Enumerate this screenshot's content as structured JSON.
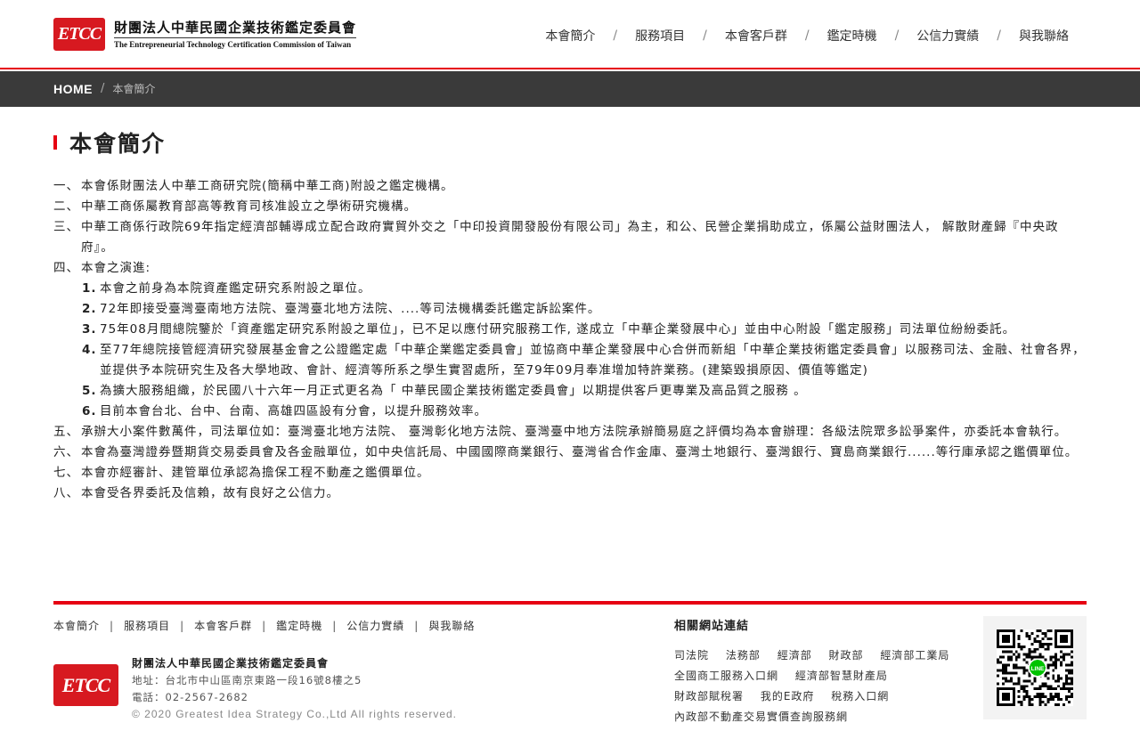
{
  "header": {
    "logo_mark": "ETCC",
    "logo_zh": "財團法人中華民國企業技術鑑定委員會",
    "logo_en": "The Entrepreneurial Technology Certification Commission of Taiwan",
    "nav": [
      "本會簡介",
      "服務項目",
      "本會客戶群",
      "鑑定時機",
      "公信力實績",
      "與我聯絡"
    ],
    "nav_sep": "/"
  },
  "breadcrumb": {
    "home": "HOME",
    "sep": "/",
    "current": "本會簡介"
  },
  "page_title": "本會簡介",
  "content": {
    "items": [
      {
        "pre": "一、",
        "text": "本會係財團法人中華工商研究院(簡稱中華工商)附設之鑑定機構。"
      },
      {
        "pre": "二、",
        "text": "中華工商係屬教育部高等教育司核准設立之學術研究機構。"
      },
      {
        "pre": "三、",
        "text": "中華工商係行政院69年指定經濟部輔導成立配合政府實貿外交之「中印投資開發股份有限公司」為主，和公、民營企業捐助成立，係屬公益財團法人， 解散財產歸『中央政府』。"
      },
      {
        "pre": "四、",
        "text": "本會之演進:"
      }
    ],
    "sub_items": [
      {
        "num": "1.",
        "text": "本會之前身為本院資產鑑定研究系附設之單位。"
      },
      {
        "num": "2.",
        "text": "72年即接受臺灣臺南地方法院、臺灣臺北地方法院、....等司法機構委託鑑定訴訟案件。"
      },
      {
        "num": "3.",
        "text": "75年08月間總院鑒於「資產鑑定研究系附設之單位」，已不足以應付研究服務工作, 遂成立「中華企業發展中心」並由中心附設「鑑定服務」司法單位紛紛委託。"
      },
      {
        "num": "4.",
        "text": "至77年總院接管經濟研究發展基金會之公證鑑定處「中華企業鑑定委員會」並協商中華企業發展中心合併而新組「中華企業技術鑑定委員會」以服務司法、金融、社會各界，並提供予本院研究生及各大學地政、會計、經濟等所系之學生實習處所，至79年09月奉准增加特許業務。(建築毀損原因、價值等鑑定)"
      },
      {
        "num": "5.",
        "text": "為擴大服務組織，於民國八十六年一月正式更名為「 中華民國企業技術鑑定委員會」以期提供客戶更專業及高品質之服務 。"
      },
      {
        "num": "6.",
        "text": "目前本會台北、台中、台南、高雄四區設有分會，以提升服務效率。"
      }
    ],
    "items_after": [
      {
        "pre": "五、",
        "text": "承辦大小案件數萬件，司法單位如：臺灣臺北地方法院、 臺灣彰化地方法院、臺灣臺中地方法院承辦簡易庭之評價均為本會辦理：各級法院眾多訟爭案件，亦委託本會執行。"
      },
      {
        "pre": "六、",
        "text": "本會為臺灣證券暨期貨交易委員會及各金融單位，如中央信託局、中國國際商業銀行、臺灣省合作金庫、臺灣土地銀行、臺灣銀行、寶島商業銀行......等行庫承認之鑑價單位。"
      },
      {
        "pre": "七、",
        "text": "本會亦經審計、建管單位承認為擔保工程不動產之鑑價單位。"
      },
      {
        "pre": "八、",
        "text": "本會受各界委託及信賴，故有良好之公信力。"
      }
    ]
  },
  "footer": {
    "nav": [
      "本會簡介",
      "服務項目",
      "本會客戶群",
      "鑑定時機",
      "公信力實績",
      "與我聯絡"
    ],
    "nav_sep": "|",
    "logo_mark": "ETCC",
    "org_name": "財團法人中華民國企業技術鑑定委員會",
    "address": "地址：台北市中山區南京東路一段16號8樓之5",
    "phone": "電話：02-2567-2682",
    "copyright": "© 2020 Greatest Idea Strategy Co.,Ltd All rights reserved.",
    "links_title": "相關網站連結",
    "links": [
      [
        "司法院",
        "法務部",
        "經濟部",
        "財政部",
        "經濟部工業局"
      ],
      [
        "全國商工服務入口網",
        "經濟部智慧財產局"
      ],
      [
        "財政部賦稅署",
        "我的E政府",
        "稅務入口網"
      ],
      [
        "內政部不動產交易實價查詢服務網"
      ]
    ],
    "qr_badge": "LINE"
  }
}
